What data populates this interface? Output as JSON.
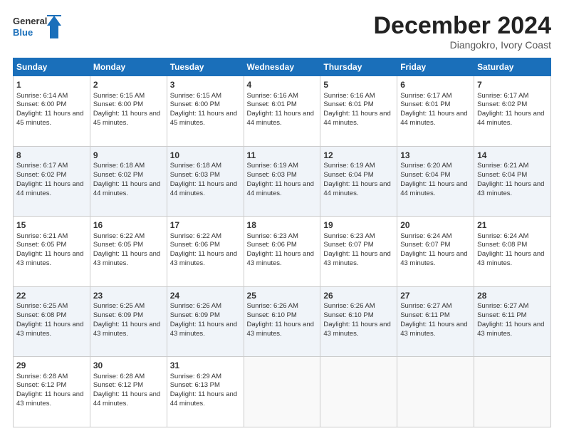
{
  "header": {
    "logo": {
      "general": "General",
      "blue": "Blue"
    },
    "title": "December 2024",
    "location": "Diangokro, Ivory Coast"
  },
  "calendar": {
    "days": [
      "Sunday",
      "Monday",
      "Tuesday",
      "Wednesday",
      "Thursday",
      "Friday",
      "Saturday"
    ],
    "weeks": [
      [
        null,
        null,
        {
          "day": 3,
          "sunrise": "6:15 AM",
          "sunset": "6:00 PM",
          "daylight": "11 hours and 45 minutes."
        },
        {
          "day": 4,
          "sunrise": "6:16 AM",
          "sunset": "6:01 PM",
          "daylight": "11 hours and 44 minutes."
        },
        {
          "day": 5,
          "sunrise": "6:16 AM",
          "sunset": "6:01 PM",
          "daylight": "11 hours and 44 minutes."
        },
        {
          "day": 6,
          "sunrise": "6:17 AM",
          "sunset": "6:01 PM",
          "daylight": "11 hours and 44 minutes."
        },
        {
          "day": 7,
          "sunrise": "6:17 AM",
          "sunset": "6:02 PM",
          "daylight": "11 hours and 44 minutes."
        }
      ],
      [
        {
          "day": 1,
          "sunrise": "6:14 AM",
          "sunset": "6:00 PM",
          "daylight": "11 hours and 45 minutes."
        },
        {
          "day": 2,
          "sunrise": "6:15 AM",
          "sunset": "6:00 PM",
          "daylight": "11 hours and 45 minutes."
        },
        {
          "day": 3,
          "sunrise": "6:15 AM",
          "sunset": "6:00 PM",
          "daylight": "11 hours and 45 minutes."
        },
        {
          "day": 4,
          "sunrise": "6:16 AM",
          "sunset": "6:01 PM",
          "daylight": "11 hours and 44 minutes."
        },
        {
          "day": 5,
          "sunrise": "6:16 AM",
          "sunset": "6:01 PM",
          "daylight": "11 hours and 44 minutes."
        },
        {
          "day": 6,
          "sunrise": "6:17 AM",
          "sunset": "6:01 PM",
          "daylight": "11 hours and 44 minutes."
        },
        {
          "day": 7,
          "sunrise": "6:17 AM",
          "sunset": "6:02 PM",
          "daylight": "11 hours and 44 minutes."
        }
      ],
      [
        {
          "day": 8,
          "sunrise": "6:17 AM",
          "sunset": "6:02 PM",
          "daylight": "11 hours and 44 minutes."
        },
        {
          "day": 9,
          "sunrise": "6:18 AM",
          "sunset": "6:02 PM",
          "daylight": "11 hours and 44 minutes."
        },
        {
          "day": 10,
          "sunrise": "6:18 AM",
          "sunset": "6:03 PM",
          "daylight": "11 hours and 44 minutes."
        },
        {
          "day": 11,
          "sunrise": "6:19 AM",
          "sunset": "6:03 PM",
          "daylight": "11 hours and 44 minutes."
        },
        {
          "day": 12,
          "sunrise": "6:19 AM",
          "sunset": "6:04 PM",
          "daylight": "11 hours and 44 minutes."
        },
        {
          "day": 13,
          "sunrise": "6:20 AM",
          "sunset": "6:04 PM",
          "daylight": "11 hours and 44 minutes."
        },
        {
          "day": 14,
          "sunrise": "6:21 AM",
          "sunset": "6:04 PM",
          "daylight": "11 hours and 43 minutes."
        }
      ],
      [
        {
          "day": 15,
          "sunrise": "6:21 AM",
          "sunset": "6:05 PM",
          "daylight": "11 hours and 43 minutes."
        },
        {
          "day": 16,
          "sunrise": "6:22 AM",
          "sunset": "6:05 PM",
          "daylight": "11 hours and 43 minutes."
        },
        {
          "day": 17,
          "sunrise": "6:22 AM",
          "sunset": "6:06 PM",
          "daylight": "11 hours and 43 minutes."
        },
        {
          "day": 18,
          "sunrise": "6:23 AM",
          "sunset": "6:06 PM",
          "daylight": "11 hours and 43 minutes."
        },
        {
          "day": 19,
          "sunrise": "6:23 AM",
          "sunset": "6:07 PM",
          "daylight": "11 hours and 43 minutes."
        },
        {
          "day": 20,
          "sunrise": "6:24 AM",
          "sunset": "6:07 PM",
          "daylight": "11 hours and 43 minutes."
        },
        {
          "day": 21,
          "sunrise": "6:24 AM",
          "sunset": "6:08 PM",
          "daylight": "11 hours and 43 minutes."
        }
      ],
      [
        {
          "day": 22,
          "sunrise": "6:25 AM",
          "sunset": "6:08 PM",
          "daylight": "11 hours and 43 minutes."
        },
        {
          "day": 23,
          "sunrise": "6:25 AM",
          "sunset": "6:09 PM",
          "daylight": "11 hours and 43 minutes."
        },
        {
          "day": 24,
          "sunrise": "6:26 AM",
          "sunset": "6:09 PM",
          "daylight": "11 hours and 43 minutes."
        },
        {
          "day": 25,
          "sunrise": "6:26 AM",
          "sunset": "6:10 PM",
          "daylight": "11 hours and 43 minutes."
        },
        {
          "day": 26,
          "sunrise": "6:26 AM",
          "sunset": "6:10 PM",
          "daylight": "11 hours and 43 minutes."
        },
        {
          "day": 27,
          "sunrise": "6:27 AM",
          "sunset": "6:11 PM",
          "daylight": "11 hours and 43 minutes."
        },
        {
          "day": 28,
          "sunrise": "6:27 AM",
          "sunset": "6:11 PM",
          "daylight": "11 hours and 43 minutes."
        }
      ],
      [
        {
          "day": 29,
          "sunrise": "6:28 AM",
          "sunset": "6:12 PM",
          "daylight": "11 hours and 43 minutes."
        },
        {
          "day": 30,
          "sunrise": "6:28 AM",
          "sunset": "6:12 PM",
          "daylight": "11 hours and 44 minutes."
        },
        {
          "day": 31,
          "sunrise": "6:29 AM",
          "sunset": "6:13 PM",
          "daylight": "11 hours and 44 minutes."
        },
        null,
        null,
        null,
        null
      ]
    ]
  }
}
